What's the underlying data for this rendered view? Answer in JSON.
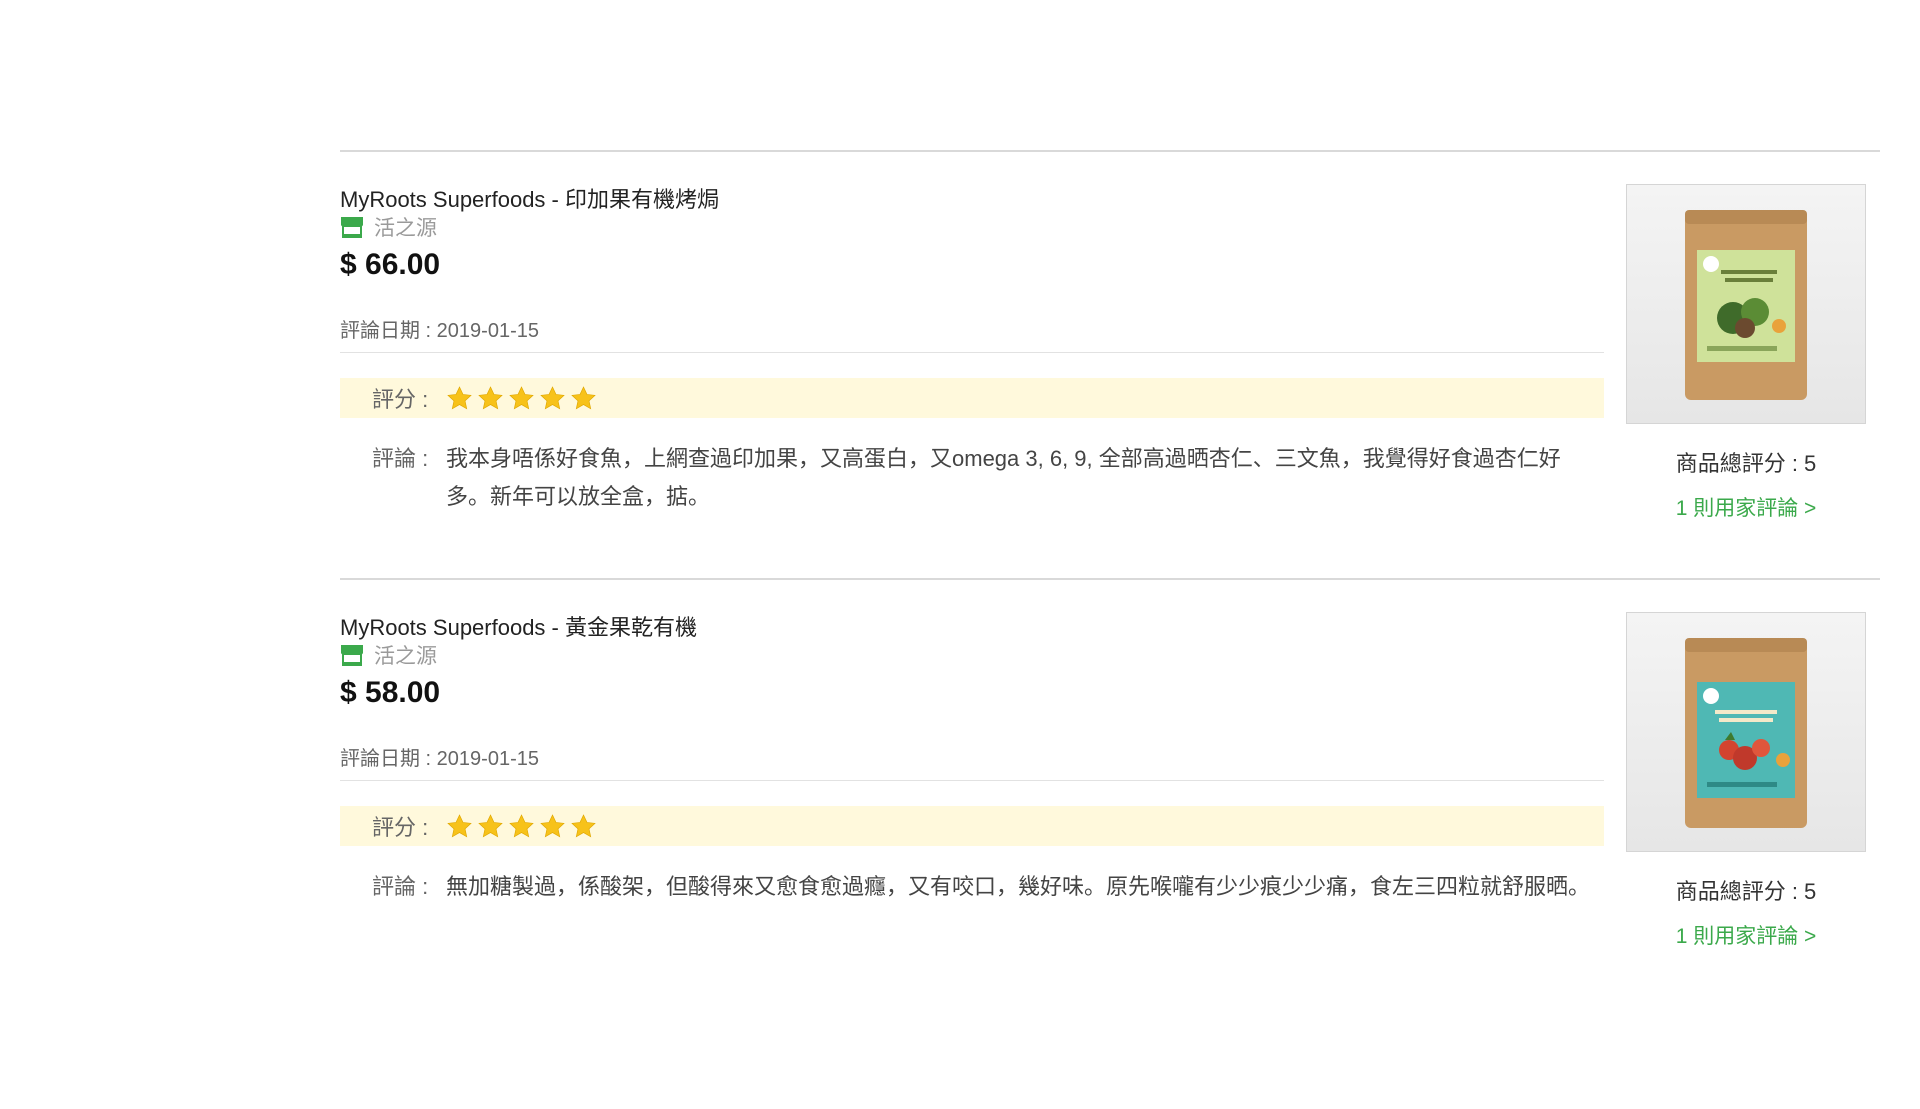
{
  "reviews": [
    {
      "title": "MyRoots Superfoods - 印加果有機烤焗",
      "shop_name": "活之源",
      "price": "$ 66.00",
      "review_date": "評論日期 : 2019-01-15",
      "rating_label": "評分 :",
      "rating": 5,
      "comment_label": "評論 :",
      "comment_text": "我本身唔係好食魚，上網查過印加果，又高蛋白，又omega 3, 6, 9, 全部高過晒杏仁、三文魚，我覺得好食過杏仁好多。新年可以放全盒，掂。",
      "total_rating": "商品總評分 : 5",
      "review_link": "1 則用家評論 >",
      "image_icon": "roasted-sacha-inchi-package",
      "package_color": "#c99a63",
      "label_color": "#cfe29a"
    },
    {
      "title": "MyRoots Superfoods - 黃金果乾有機",
      "shop_name": "活之源",
      "price": "$ 58.00",
      "review_date": "評論日期 : 2019-01-15",
      "rating_label": "評分 :",
      "rating": 5,
      "comment_label": "評論 :",
      "comment_text": "無加糖製過，係酸架，但酸得來又愈食愈過癮，又有咬口，幾好味。原先喉嚨有少少痕少少痛，食左三四粒就舒服晒。",
      "total_rating": "商品總評分 : 5",
      "review_link": "1 則用家評論 >",
      "image_icon": "dried-golden-berries-package",
      "package_color": "#c99a63",
      "label_color": "#4fb8b4"
    }
  ],
  "colors": {
    "accent_green": "#3ba94b",
    "star_yellow": "#f7c21a",
    "rating_bg": "#fff9dc"
  }
}
